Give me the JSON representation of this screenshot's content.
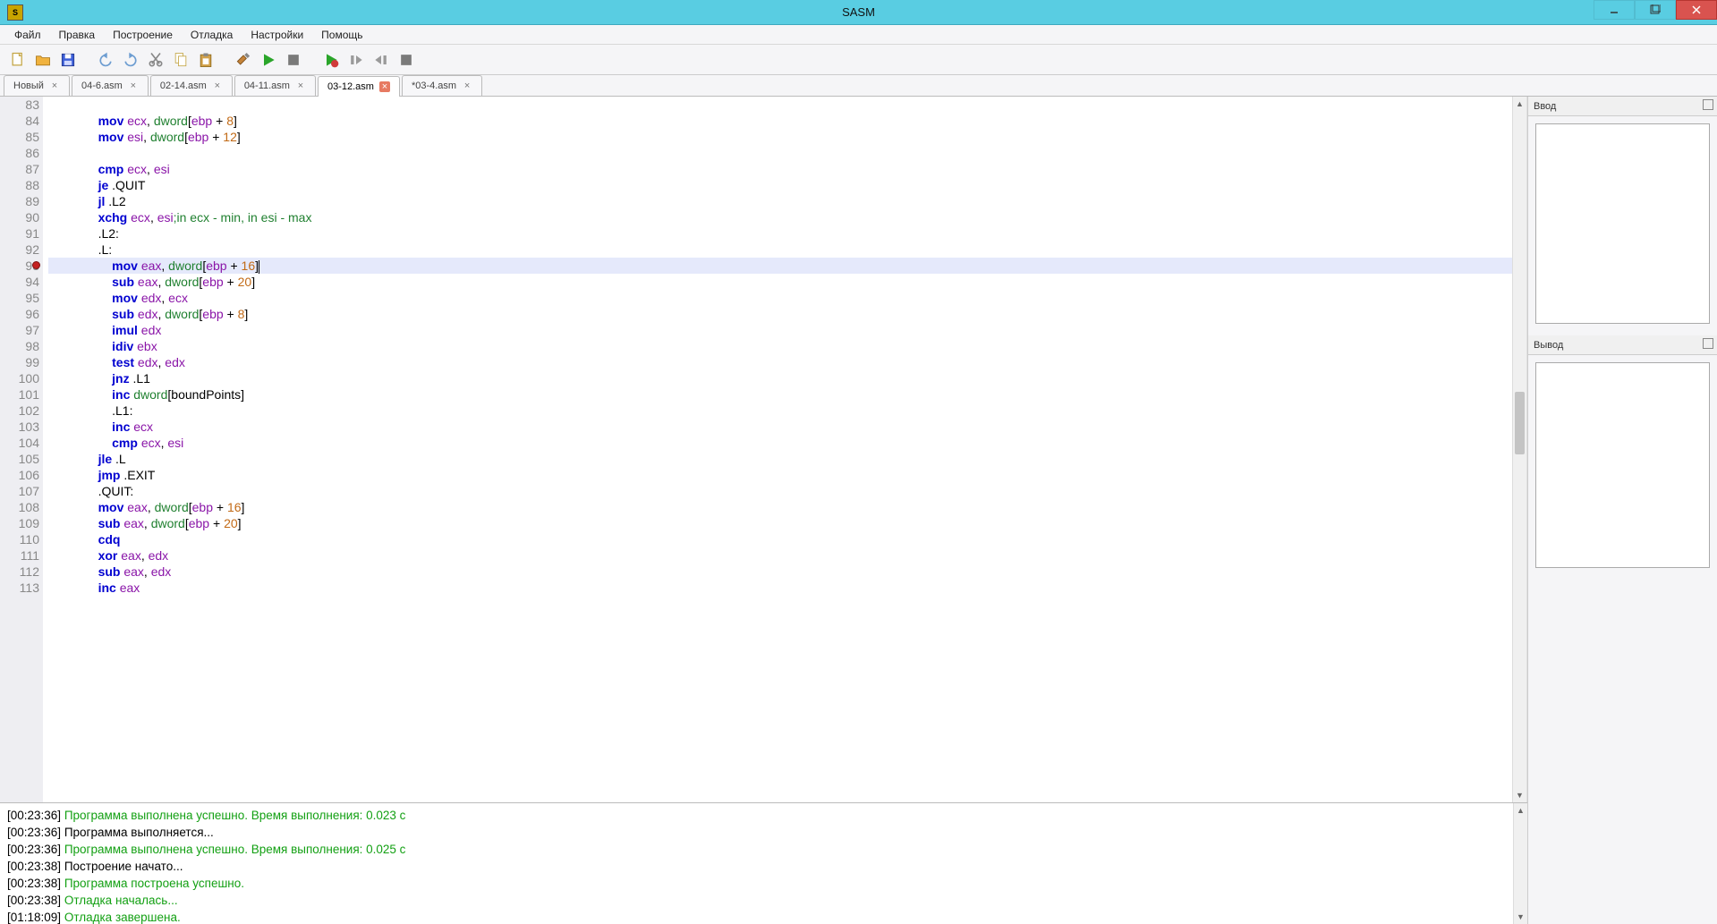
{
  "app": {
    "title": "SASM"
  },
  "menu": [
    "Файл",
    "Правка",
    "Построение",
    "Отладка",
    "Настройки",
    "Помощь"
  ],
  "toolbar_icons": [
    "new-file-icon",
    "open-file-icon",
    "save-icon",
    "undo-icon",
    "redo-icon",
    "cut-icon",
    "copy-icon",
    "paste-icon",
    "build-icon",
    "run-icon",
    "stop-icon",
    "debug-icon",
    "step-over-icon",
    "step-out-icon",
    "continue-icon"
  ],
  "tabs": [
    {
      "label": "Новый",
      "active": false,
      "dirty": false
    },
    {
      "label": "04-6.asm",
      "active": false,
      "dirty": false
    },
    {
      "label": "02-14.asm",
      "active": false,
      "dirty": false
    },
    {
      "label": "04-11.asm",
      "active": false,
      "dirty": false
    },
    {
      "label": "03-12.asm",
      "active": true,
      "dirty": false
    },
    {
      "label": "*03-4.asm",
      "active": false,
      "dirty": true
    }
  ],
  "right_panels": {
    "input_label": "Ввод",
    "output_label": "Вывод",
    "input_value": "",
    "output_value": ""
  },
  "editor": {
    "starting_line": 83,
    "current_line_idx": 10,
    "breakpoints": [
      10
    ],
    "lines": [
      [],
      [
        {
          "indent": 1
        },
        {
          "t": "mov",
          "c": "kw"
        },
        {
          "t": " "
        },
        {
          "t": "ecx",
          "c": "reg"
        },
        {
          "t": ", ",
          "c": "pun"
        },
        {
          "t": "dword",
          "c": "typ"
        },
        {
          "t": "[",
          "c": "pun"
        },
        {
          "t": "ebp",
          "c": "reg"
        },
        {
          "t": " + ",
          "c": "pun"
        },
        {
          "t": "8",
          "c": "num"
        },
        {
          "t": "]",
          "c": "pun"
        }
      ],
      [
        {
          "indent": 1
        },
        {
          "t": "mov",
          "c": "kw"
        },
        {
          "t": " "
        },
        {
          "t": "esi",
          "c": "reg"
        },
        {
          "t": ", ",
          "c": "pun"
        },
        {
          "t": "dword",
          "c": "typ"
        },
        {
          "t": "[",
          "c": "pun"
        },
        {
          "t": "ebp",
          "c": "reg"
        },
        {
          "t": " + ",
          "c": "pun"
        },
        {
          "t": "12",
          "c": "num"
        },
        {
          "t": "]",
          "c": "pun"
        }
      ],
      [],
      [
        {
          "indent": 1
        },
        {
          "t": "cmp",
          "c": "kw"
        },
        {
          "t": " "
        },
        {
          "t": "ecx",
          "c": "reg"
        },
        {
          "t": ", ",
          "c": "pun"
        },
        {
          "t": "esi",
          "c": "reg"
        }
      ],
      [
        {
          "indent": 1
        },
        {
          "t": "je",
          "c": "kw"
        },
        {
          "t": " .QUIT",
          "c": "lbl"
        }
      ],
      [
        {
          "indent": 1
        },
        {
          "t": "jl",
          "c": "kw"
        },
        {
          "t": " .L2",
          "c": "lbl"
        }
      ],
      [
        {
          "indent": 1
        },
        {
          "t": "xchg",
          "c": "kw"
        },
        {
          "t": " "
        },
        {
          "t": "ecx",
          "c": "reg"
        },
        {
          "t": ", ",
          "c": "pun"
        },
        {
          "t": "esi",
          "c": "reg"
        },
        {
          "t": ";in ecx - min, in esi - max",
          "c": "cmt"
        }
      ],
      [
        {
          "indent": 1
        },
        {
          "t": ".L2:",
          "c": "lbl"
        }
      ],
      [
        {
          "indent": 1
        },
        {
          "t": ".L:",
          "c": "lbl"
        }
      ],
      [
        {
          "indent": 2
        },
        {
          "t": "mov",
          "c": "kw"
        },
        {
          "t": " "
        },
        {
          "t": "eax",
          "c": "reg"
        },
        {
          "t": ", ",
          "c": "pun"
        },
        {
          "t": "dword",
          "c": "typ"
        },
        {
          "t": "[",
          "c": "pun"
        },
        {
          "t": "ebp",
          "c": "reg"
        },
        {
          "t": " + ",
          "c": "pun"
        },
        {
          "t": "16",
          "c": "num"
        },
        {
          "t": "]",
          "c": "pun"
        },
        {
          "cursor": true
        }
      ],
      [
        {
          "indent": 2
        },
        {
          "t": "sub",
          "c": "kw"
        },
        {
          "t": " "
        },
        {
          "t": "eax",
          "c": "reg"
        },
        {
          "t": ", ",
          "c": "pun"
        },
        {
          "t": "dword",
          "c": "typ"
        },
        {
          "t": "[",
          "c": "pun"
        },
        {
          "t": "ebp",
          "c": "reg"
        },
        {
          "t": " + ",
          "c": "pun"
        },
        {
          "t": "20",
          "c": "num"
        },
        {
          "t": "]",
          "c": "pun"
        }
      ],
      [
        {
          "indent": 2
        },
        {
          "t": "mov",
          "c": "kw"
        },
        {
          "t": " "
        },
        {
          "t": "edx",
          "c": "reg"
        },
        {
          "t": ", ",
          "c": "pun"
        },
        {
          "t": "ecx",
          "c": "reg"
        }
      ],
      [
        {
          "indent": 2
        },
        {
          "t": "sub",
          "c": "kw"
        },
        {
          "t": " "
        },
        {
          "t": "edx",
          "c": "reg"
        },
        {
          "t": ", ",
          "c": "pun"
        },
        {
          "t": "dword",
          "c": "typ"
        },
        {
          "t": "[",
          "c": "pun"
        },
        {
          "t": "ebp",
          "c": "reg"
        },
        {
          "t": " + ",
          "c": "pun"
        },
        {
          "t": "8",
          "c": "num"
        },
        {
          "t": "]",
          "c": "pun"
        }
      ],
      [
        {
          "indent": 2
        },
        {
          "t": "imul",
          "c": "kw"
        },
        {
          "t": " "
        },
        {
          "t": "edx",
          "c": "reg"
        }
      ],
      [
        {
          "indent": 2
        },
        {
          "t": "idiv",
          "c": "kw"
        },
        {
          "t": " "
        },
        {
          "t": "ebx",
          "c": "reg"
        }
      ],
      [
        {
          "indent": 2
        },
        {
          "t": "test",
          "c": "kw"
        },
        {
          "t": " "
        },
        {
          "t": "edx",
          "c": "reg"
        },
        {
          "t": ", ",
          "c": "pun"
        },
        {
          "t": "edx",
          "c": "reg"
        }
      ],
      [
        {
          "indent": 2
        },
        {
          "t": "jnz",
          "c": "kw"
        },
        {
          "t": " .L1",
          "c": "lbl"
        }
      ],
      [
        {
          "indent": 2
        },
        {
          "t": "inc",
          "c": "kw"
        },
        {
          "t": " "
        },
        {
          "t": "dword",
          "c": "typ"
        },
        {
          "t": "[",
          "c": "pun"
        },
        {
          "t": "boundPoints",
          "c": "lbl"
        },
        {
          "t": "]",
          "c": "pun"
        }
      ],
      [
        {
          "indent": 2
        },
        {
          "t": ".L1:",
          "c": "lbl"
        }
      ],
      [
        {
          "indent": 2
        },
        {
          "t": "inc",
          "c": "kw"
        },
        {
          "t": " "
        },
        {
          "t": "ecx",
          "c": "reg"
        }
      ],
      [
        {
          "indent": 2
        },
        {
          "t": "cmp",
          "c": "kw"
        },
        {
          "t": " "
        },
        {
          "t": "ecx",
          "c": "reg"
        },
        {
          "t": ", ",
          "c": "pun"
        },
        {
          "t": "esi",
          "c": "reg"
        }
      ],
      [
        {
          "indent": 1
        },
        {
          "t": "jle",
          "c": "kw"
        },
        {
          "t": " .L",
          "c": "lbl"
        }
      ],
      [
        {
          "indent": 1
        },
        {
          "t": "jmp",
          "c": "kw"
        },
        {
          "t": " .EXIT",
          "c": "lbl"
        }
      ],
      [
        {
          "indent": 1
        },
        {
          "t": ".QUIT:",
          "c": "lbl"
        }
      ],
      [
        {
          "indent": 1
        },
        {
          "t": "mov",
          "c": "kw"
        },
        {
          "t": " "
        },
        {
          "t": "eax",
          "c": "reg"
        },
        {
          "t": ", ",
          "c": "pun"
        },
        {
          "t": "dword",
          "c": "typ"
        },
        {
          "t": "[",
          "c": "pun"
        },
        {
          "t": "ebp",
          "c": "reg"
        },
        {
          "t": " + ",
          "c": "pun"
        },
        {
          "t": "16",
          "c": "num"
        },
        {
          "t": "]",
          "c": "pun"
        }
      ],
      [
        {
          "indent": 1
        },
        {
          "t": "sub",
          "c": "kw"
        },
        {
          "t": " "
        },
        {
          "t": "eax",
          "c": "reg"
        },
        {
          "t": ", ",
          "c": "pun"
        },
        {
          "t": "dword",
          "c": "typ"
        },
        {
          "t": "[",
          "c": "pun"
        },
        {
          "t": "ebp",
          "c": "reg"
        },
        {
          "t": " + ",
          "c": "pun"
        },
        {
          "t": "20",
          "c": "num"
        },
        {
          "t": "]",
          "c": "pun"
        }
      ],
      [
        {
          "indent": 1
        },
        {
          "t": "cdq",
          "c": "kw"
        }
      ],
      [
        {
          "indent": 1
        },
        {
          "t": "xor",
          "c": "kw"
        },
        {
          "t": " "
        },
        {
          "t": "eax",
          "c": "reg"
        },
        {
          "t": ", ",
          "c": "pun"
        },
        {
          "t": "edx",
          "c": "reg"
        }
      ],
      [
        {
          "indent": 1
        },
        {
          "t": "sub",
          "c": "kw"
        },
        {
          "t": " "
        },
        {
          "t": "eax",
          "c": "reg"
        },
        {
          "t": ", ",
          "c": "pun"
        },
        {
          "t": "edx",
          "c": "reg"
        }
      ],
      [
        {
          "indent": 1
        },
        {
          "t": "inc",
          "c": "kw"
        },
        {
          "t": " "
        },
        {
          "t": "eax",
          "c": "reg"
        }
      ]
    ]
  },
  "log": [
    {
      "ts": "[00:23:36]",
      "text": "Программа выполнена успешно. Время выполнения: 0.023 с",
      "style": "ok"
    },
    {
      "ts": "[00:23:36]",
      "text": "Программа выполняется...",
      "style": "plain"
    },
    {
      "ts": "[00:23:36]",
      "text": "Программа выполнена успешно. Время выполнения: 0.025 с",
      "style": "ok"
    },
    {
      "ts": "[00:23:38]",
      "text": "Построение начато...",
      "style": "plain"
    },
    {
      "ts": "[00:23:38]",
      "text": "Программа построена успешно.",
      "style": "ok"
    },
    {
      "ts": "[00:23:38]",
      "text": "Отладка началась...",
      "style": "ok"
    },
    {
      "ts": "[01:18:09]",
      "text": "Отладка завершена.",
      "style": "ok"
    }
  ]
}
